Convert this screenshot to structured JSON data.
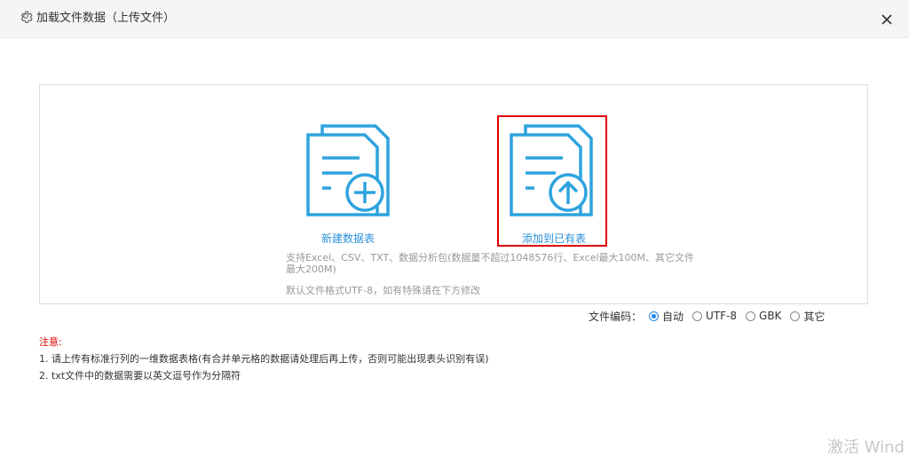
{
  "dialog": {
    "title": "加载文件数据（上传文件）"
  },
  "options": {
    "new_table_label": "新建数据表",
    "add_existing_label": "添加到已有表"
  },
  "info": {
    "support_text": "支持Excel、CSV、TXT、数据分析包(数据量不超过1048576行、Excel最大100M、其它文件最大200M)",
    "default_text": "默认文件格式UTF-8，如有特殊请在下方修改"
  },
  "encoding": {
    "label": "文件编码：",
    "options": [
      "自动",
      "UTF-8",
      "GBK",
      "其它"
    ],
    "selected": "自动"
  },
  "notes": {
    "title": "注意:",
    "lines": [
      "1. 请上传有标准行列的一维数据表格(有合并单元格的数据请处理后再上传，否则可能出现表头识别有误)",
      "2. txt文件中的数据需要以英文逗号作为分隔符"
    ]
  },
  "watermark": "激活 Wind",
  "colors": {
    "accent": "#2b90d9",
    "highlight_border": "#e00000",
    "note_title": "#e00000"
  }
}
